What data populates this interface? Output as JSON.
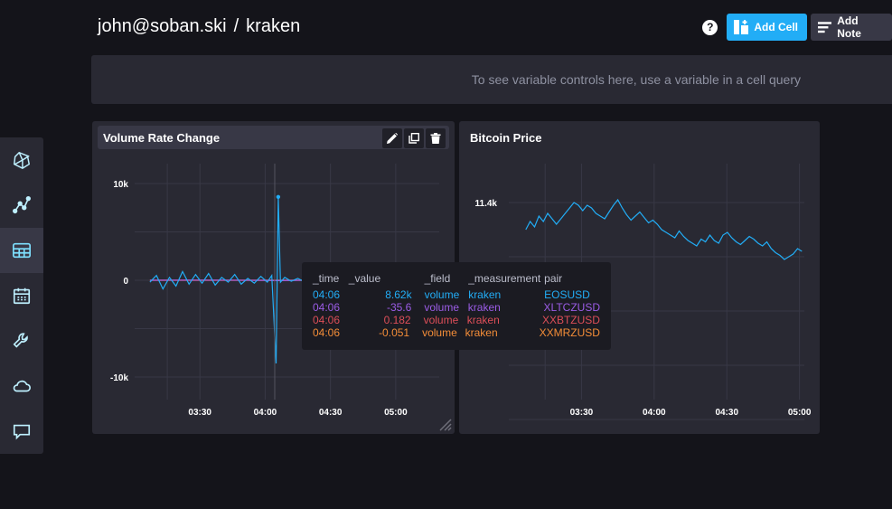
{
  "header": {
    "user": "john@soban.ski",
    "separator": "/",
    "dashboard": "kraken",
    "help": "?",
    "add_cell": "Add Cell",
    "add_note": "Add Note"
  },
  "variables": {
    "message": "To see variable controls here, use a variable in a cell query"
  },
  "sidebar": {
    "items": [
      {
        "name": "logo",
        "icon": "influx-logo-icon"
      },
      {
        "name": "data-explorer",
        "icon": "graph-icon"
      },
      {
        "name": "dashboards",
        "icon": "dashboard-icon",
        "active": true
      },
      {
        "name": "tasks",
        "icon": "calendar-icon"
      },
      {
        "name": "settings",
        "icon": "wrench-icon"
      },
      {
        "name": "cloud",
        "icon": "cloud-icon"
      },
      {
        "name": "feedback",
        "icon": "chat-icon"
      }
    ]
  },
  "colors": {
    "accent": "#22adf6",
    "eosusd": "#22adf6",
    "xltczusd": "#9b5ce6",
    "xxbtzusd": "#dc4e58",
    "xxmrzusd": "#f48d38"
  },
  "cells": {
    "volume": {
      "title": "Volume Rate Change"
    },
    "bitcoin": {
      "title": "Bitcoin Price"
    }
  },
  "tooltip": {
    "headers": [
      "_time",
      "_value",
      "_field",
      "_measurement",
      "pair"
    ],
    "rows": [
      {
        "time": "04:06",
        "value": "8.62k",
        "field": "volume",
        "measurement": "kraken",
        "pair": "EOSUSD",
        "color": "#22adf6"
      },
      {
        "time": "04:06",
        "value": "-35.6",
        "field": "volume",
        "measurement": "kraken",
        "pair": "XLTCZUSD",
        "color": "#9b5ce6"
      },
      {
        "time": "04:06",
        "value": "0.182",
        "field": "volume",
        "measurement": "kraken",
        "pair": "XXBTZUSD",
        "color": "#dc4e58"
      },
      {
        "time": "04:06",
        "value": "-0.051",
        "field": "volume",
        "measurement": "kraken",
        "pair": "XXMRZUSD",
        "color": "#f48d38"
      }
    ]
  },
  "chart_data": [
    {
      "type": "line",
      "title": "Volume Rate Change",
      "x_ticks": [
        "03:30",
        "04:00",
        "04:30",
        "05:00"
      ],
      "y_ticks": [
        "10k",
        "0",
        "-10k"
      ],
      "ylim": [
        -10000,
        10000
      ],
      "grid": true,
      "series": [
        {
          "name": "EOSUSD",
          "color": "#22adf6",
          "x": [
            "03:07",
            "03:10",
            "03:13",
            "03:16",
            "03:19",
            "03:22",
            "03:25",
            "03:28",
            "03:31",
            "03:34",
            "03:37",
            "03:40",
            "03:43",
            "03:46",
            "03:49",
            "03:52",
            "03:55",
            "03:58",
            "04:01",
            "04:03",
            "04:05",
            "04:06",
            "04:07",
            "04:09",
            "04:12",
            "04:15",
            "04:18",
            "04:21"
          ],
          "values": [
            -200,
            500,
            -900,
            300,
            -600,
            900,
            -400,
            600,
            -300,
            700,
            -500,
            300,
            -200,
            600,
            -400,
            200,
            -300,
            400,
            -200,
            500,
            -8600,
            8620,
            -200,
            300,
            -100,
            200,
            -150,
            100
          ]
        },
        {
          "name": "XLTCZUSD",
          "color": "#9b5ce6",
          "x": [
            "03:07",
            "03:30",
            "04:00",
            "04:06",
            "04:21"
          ],
          "values": [
            0,
            20,
            -10,
            -35.6,
            5
          ]
        },
        {
          "name": "XXBTZUSD",
          "color": "#dc4e58",
          "x": [
            "03:07",
            "03:30",
            "04:00",
            "04:06",
            "04:21"
          ],
          "values": [
            0,
            0.1,
            0.05,
            0.182,
            0
          ]
        },
        {
          "name": "XXMRZUSD",
          "color": "#f48d38",
          "x": [
            "03:07",
            "03:30",
            "04:00",
            "04:06",
            "04:21"
          ],
          "values": [
            0,
            0.02,
            -0.03,
            -0.051,
            0
          ]
        }
      ]
    },
    {
      "type": "line",
      "title": "Bitcoin Price",
      "x_ticks": [
        "03:30",
        "04:00",
        "04:30",
        "05:00"
      ],
      "y_ticks": [
        "11.4k"
      ],
      "grid": true,
      "series": [
        {
          "name": "",
          "color": "#22adf6",
          "values": [
            11200,
            11260,
            11220,
            11300,
            11260,
            11320,
            11280,
            11240,
            11280,
            11320,
            11360,
            11400,
            11380,
            11340,
            11380,
            11360,
            11320,
            11300,
            11280,
            11330,
            11380,
            11420,
            11360,
            11310,
            11270,
            11300,
            11330,
            11290,
            11250,
            11270,
            11240,
            11200,
            11180,
            11160,
            11140,
            11190,
            11150,
            11120,
            11100,
            11080,
            11130,
            11110,
            11160,
            11120,
            11100,
            11160,
            11180,
            11140,
            11110,
            11090,
            11120,
            11150,
            11130,
            11100,
            11080,
            11110,
            11060,
            11030,
            11010,
            10980,
            11000,
            11020,
            11060,
            11040
          ]
        }
      ]
    }
  ]
}
